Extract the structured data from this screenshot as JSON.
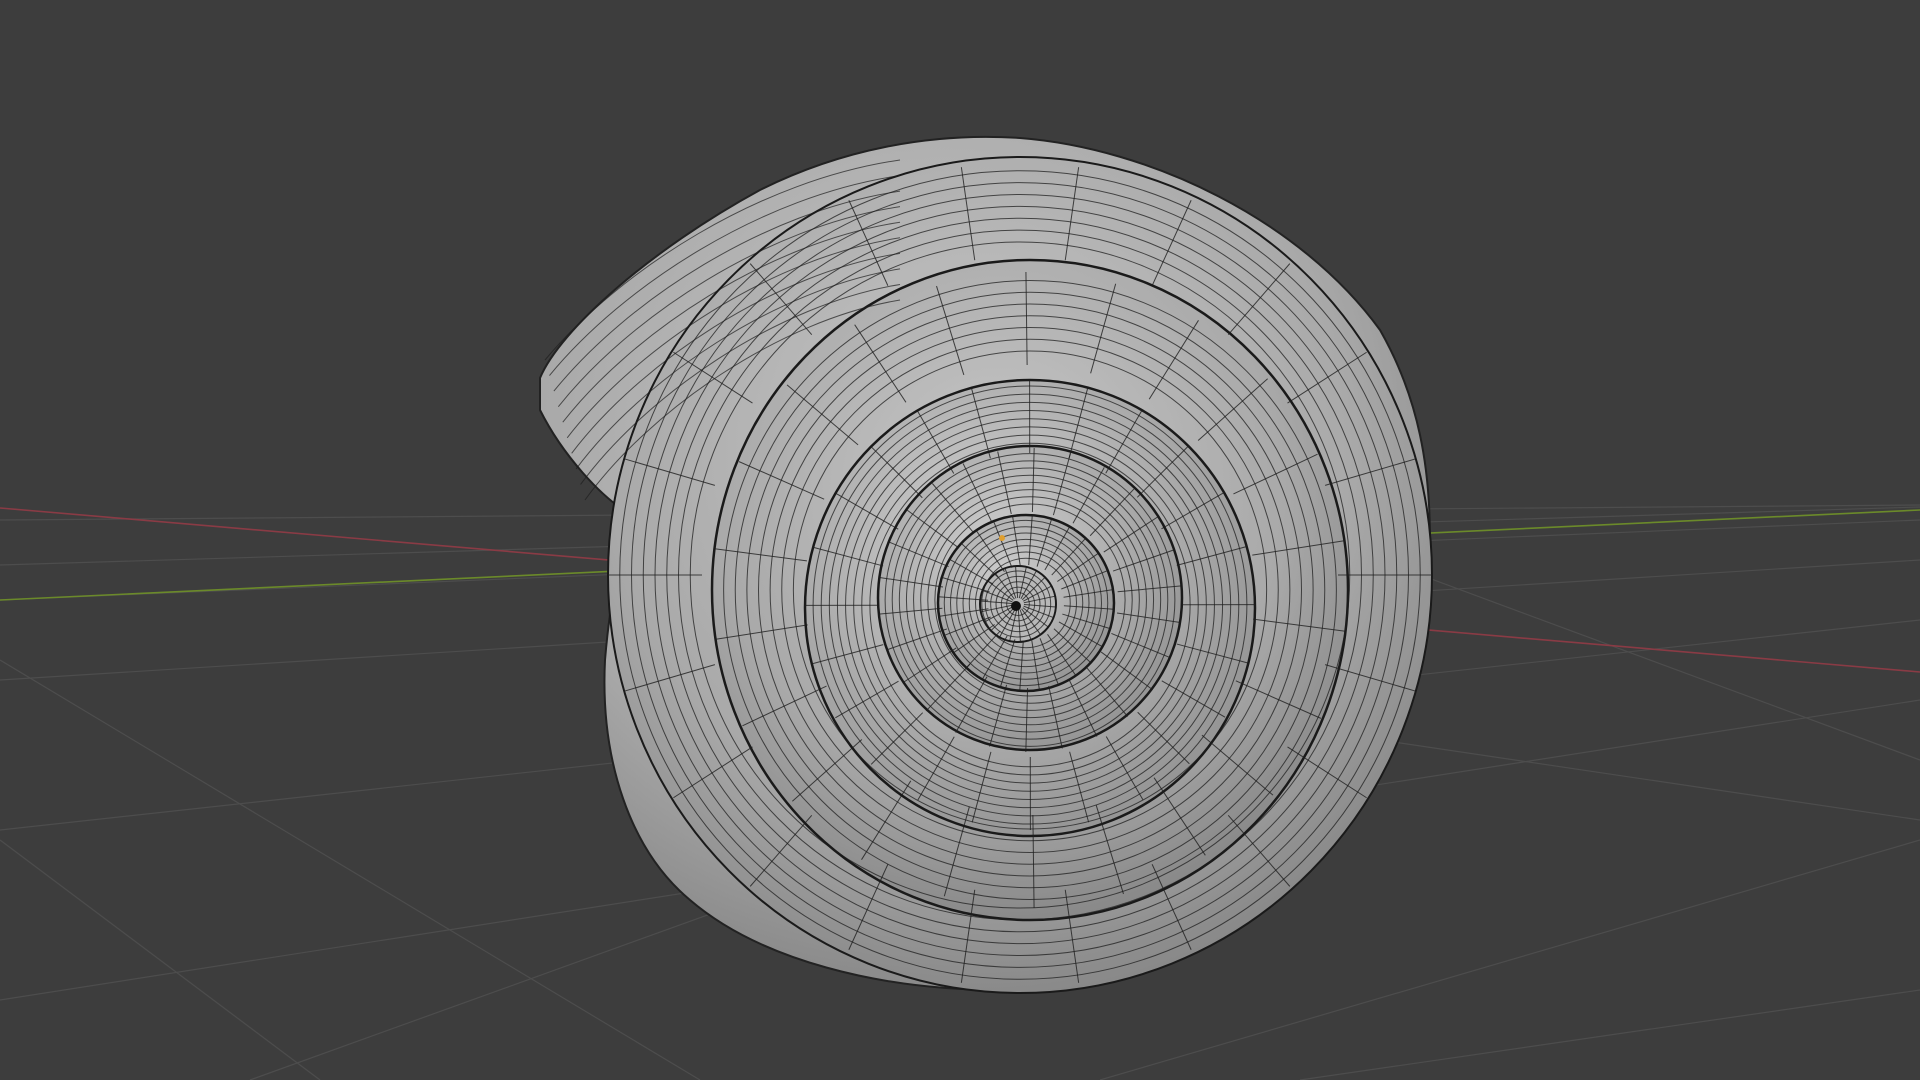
{
  "viewport": {
    "view_mode": "solid-shading-wireframe-overlay",
    "object": "spiral-shell-mesh",
    "floor_grid": true,
    "axes_visible": [
      "x",
      "y"
    ]
  },
  "colors": {
    "background": "#3d3d3d",
    "grid_line": "#4c4c4c",
    "axis_x": "#8a3b45",
    "axis_y": "#6b8a2a",
    "mesh_fill": "#a6a6a6",
    "mesh_highlight": "#c4c4c4",
    "mesh_shadow": "#727272",
    "wire": "#1c1c1c",
    "origin_dot": "#e0a030"
  }
}
